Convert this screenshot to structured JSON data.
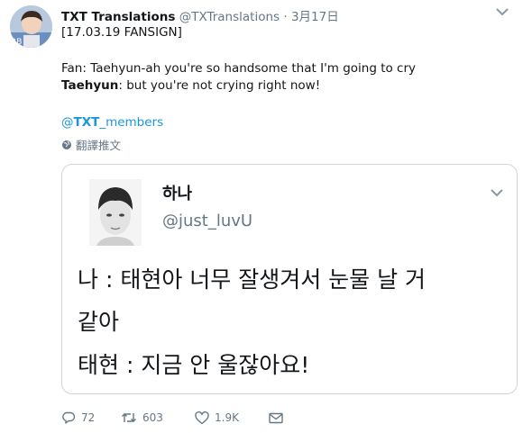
{
  "tweet": {
    "display_name": "TXT Translations",
    "handle": "@TXTranslations",
    "separator": "·",
    "time": "3月17日",
    "lines": {
      "tag": "[17.03.19 FANSIGN]",
      "fan": "Fan: Taehyun-ah you're so handsome that I'm going to cry",
      "reply_speaker": "Taehyun",
      "reply_text": ": but you're not crying right now!",
      "mention_at": "@",
      "mention_bold": "TXT",
      "mention_rest": "_members"
    },
    "translate_label": "翻譯推文"
  },
  "quoted": {
    "display_name": "하나",
    "handle": "@just_luvU",
    "lines": [
      "나 : 태현아 너무 잘생겨서 눈물 날 거",
      "같아",
      "태현 : 지금 안 울잖아요!"
    ]
  },
  "actions": {
    "reply_count": "72",
    "retweet_count": "603",
    "like_count": "1.9K"
  },
  "colors": {
    "link": "#1b95e0",
    "muted": "#657786",
    "border": "#ccd6dd"
  }
}
